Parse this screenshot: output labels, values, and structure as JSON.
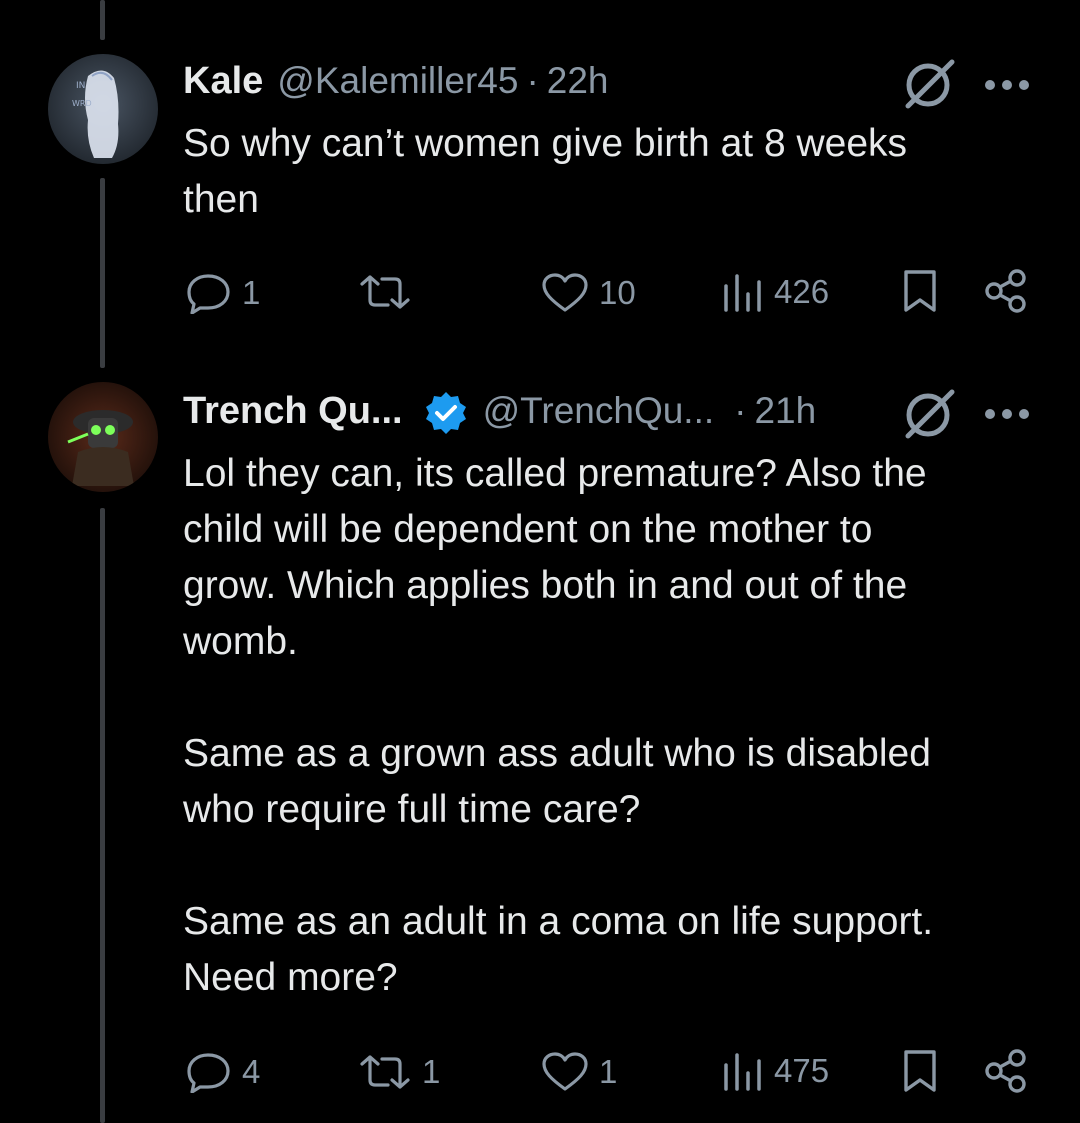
{
  "tweets": [
    {
      "name": "Kale",
      "handle": "@Kalemiller45",
      "separator": "·",
      "time": "22h",
      "avatar_icon": "ghost-avatar",
      "verified": false,
      "text": [
        "So why can’t women give birth at 8 weeks",
        "then"
      ],
      "stats": {
        "replies": "1",
        "reposts": "",
        "likes": "10",
        "views": "426"
      }
    },
    {
      "name": "Trench Qu...",
      "handle": "@TrenchQu...",
      "separator": "·",
      "time": "21h",
      "avatar_icon": "soldier-avatar",
      "verified": true,
      "text": [
        "Lol they can, its called premature? Also the",
        "child will be dependent on the mother to",
        "grow. Which applies both in and out of the",
        "womb."
      ],
      "text2": [
        "Same as a grown ass adult who is disabled",
        "who require full time care?"
      ],
      "text3": [
        "Same as an adult in a coma on life support.",
        "Need more?"
      ],
      "stats": {
        "replies": "4",
        "reposts": "1",
        "likes": "1",
        "views": "475"
      }
    }
  ],
  "colors": {
    "background": "#000000",
    "text": "#e7e9ea",
    "muted": "#8b98a5",
    "verified": "#1d9bf0",
    "thread_line": "#3a3d41"
  }
}
